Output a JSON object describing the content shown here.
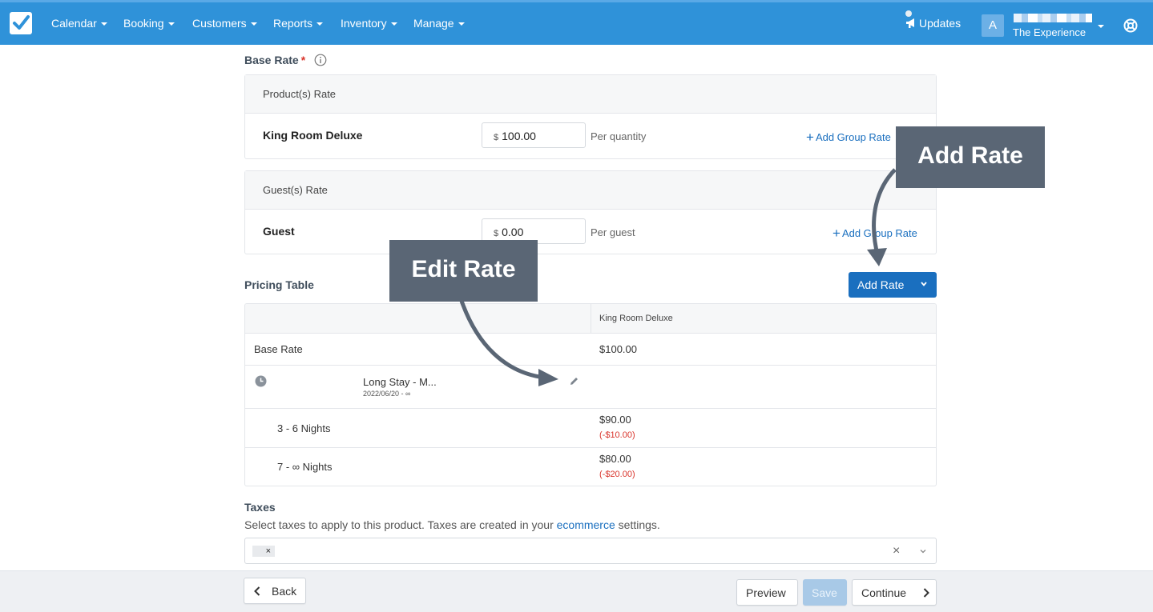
{
  "nav": {
    "items": [
      {
        "label": "Calendar"
      },
      {
        "label": "Booking"
      },
      {
        "label": "Customers"
      },
      {
        "label": "Reports"
      },
      {
        "label": "Inventory"
      },
      {
        "label": "Manage"
      }
    ],
    "updates_label": "Updates",
    "avatar_letter": "A",
    "account_name": "The Experience"
  },
  "base_rate": {
    "title": "Base Rate",
    "required_mark": "*"
  },
  "products_panel": {
    "header": "Product(s) Rate",
    "row_name": "King Room Deluxe",
    "currency": "$",
    "amount": "100.00",
    "per": "Per quantity",
    "add_group_rate": "Add Group Rate"
  },
  "guests_panel": {
    "header": "Guest(s) Rate",
    "row_name": "Guest",
    "currency": "$",
    "amount": "0.00",
    "per": "Per guest",
    "add_group_rate": "Add Group Rate"
  },
  "pricing_table": {
    "title": "Pricing Table",
    "add_rate_label": "Add Rate",
    "column_header": "King Room Deluxe",
    "base_rate_label": "Base Rate",
    "base_rate_value": "$100.00",
    "rule_name": "Long Stay - M...",
    "rule_dates": "2022/06/20 - ∞",
    "tiers": [
      {
        "label": "3 - 6 Nights",
        "value": "$90.00",
        "diff": "(-$10.00)"
      },
      {
        "label": "7 - ∞ Nights",
        "value": "$80.00",
        "diff": "(-$20.00)"
      }
    ]
  },
  "taxes": {
    "title": "Taxes",
    "desc_before": "Select taxes to apply to this product. Taxes are created in your ",
    "desc_link": "ecommerce",
    "desc_after": " settings.",
    "chip_remove": "×",
    "clear": "×"
  },
  "footer": {
    "back": "Back",
    "preview": "Preview",
    "save": "Save",
    "continue": "Continue"
  },
  "annotations": {
    "add_rate": "Add Rate",
    "edit_rate": "Edit Rate"
  },
  "colors": {
    "nav_bg": "#2f92d9",
    "primary": "#1a6fbf",
    "danger": "#d9342b",
    "callout": "#5a6675"
  }
}
